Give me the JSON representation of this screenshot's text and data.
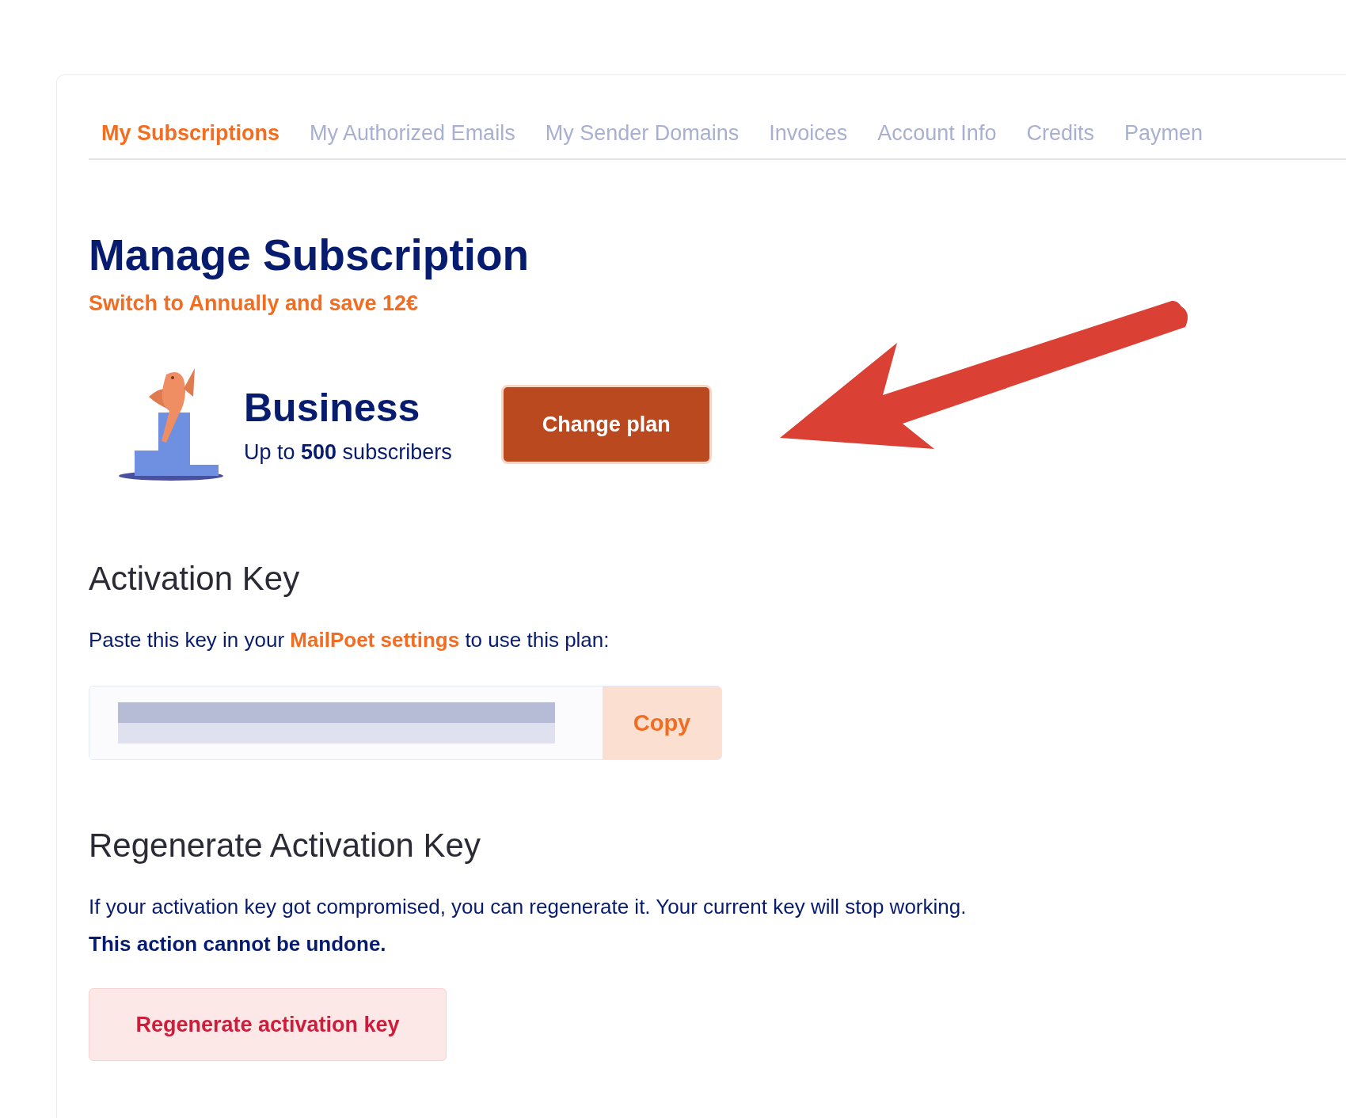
{
  "tabs": [
    {
      "label": "My Subscriptions",
      "selected": true
    },
    {
      "label": "My Authorized Emails",
      "selected": false
    },
    {
      "label": "My Sender Domains",
      "selected": false
    },
    {
      "label": "Invoices",
      "selected": false
    },
    {
      "label": "Account Info",
      "selected": false
    },
    {
      "label": "Credits",
      "selected": false
    },
    {
      "label": "Paymen",
      "selected": false
    }
  ],
  "title": "Manage Subscription",
  "promo": "Switch to Annually and save 12€",
  "plan": {
    "name": "Business",
    "detail": "Up to **500** subscribers",
    "button": "Change plan"
  },
  "activation": {
    "heading": "Activation Key",
    "text_before": "Paste this key in your ",
    "link": "MailPoet settings",
    "text_after": " to use this plan:",
    "copy_button": "Copy"
  },
  "regenerate": {
    "heading": "Regenerate Activation Key",
    "text": "If your activation key got compromised, you can regenerate it. Your current key will stop working.",
    "warning": "This action cannot be undone.",
    "button": "Regenerate activation key"
  }
}
